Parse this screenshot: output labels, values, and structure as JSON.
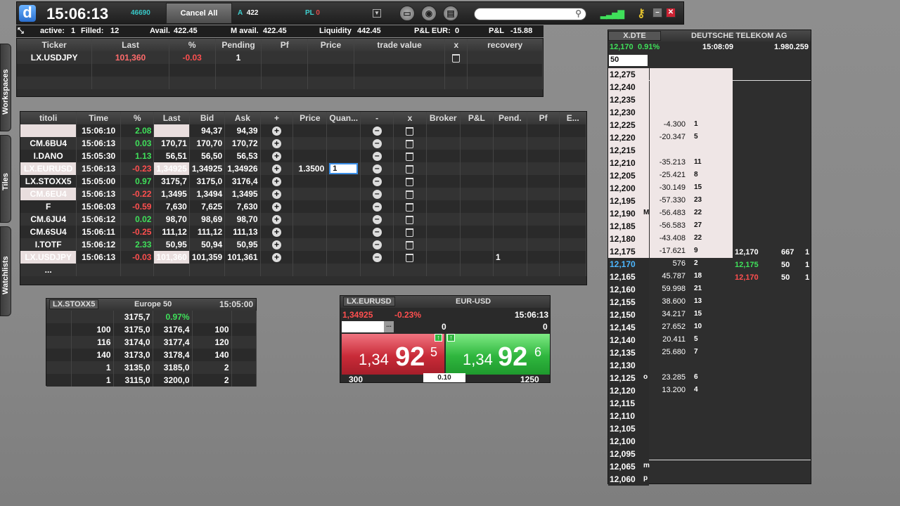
{
  "toolbar": {
    "logo": "d",
    "time": "15:06:13",
    "counter": "46690",
    "cancel_all": "Cancel All",
    "a_label": "A",
    "a_value": "422",
    "pl_label": "PL",
    "pl_value": "0",
    "search_placeholder": ""
  },
  "status": {
    "active_label": "active:",
    "active": "1",
    "filled_label": "Filled:",
    "filled": "12",
    "avail_label": "Avail.",
    "avail": "422.45",
    "mavail_label": "M avail.",
    "mavail": "422.45",
    "liquidity_label": "Liquidity",
    "liquidity": "442.45",
    "pleur_label": "P&L EUR:",
    "pleur": "0",
    "pl_label": "P&L",
    "pl": "-15.88"
  },
  "orders": {
    "columns": [
      "Ticker",
      "Last",
      "%",
      "Pending",
      "Pf",
      "Price",
      "trade value",
      "x",
      "recovery"
    ],
    "rows": [
      {
        "ticker": "LX.USDJPY",
        "last": "101,360",
        "pct": "-0.03",
        "pending": "1"
      }
    ]
  },
  "watchlist": {
    "columns": [
      "titoli",
      "Time",
      "%",
      "Last",
      "Bid",
      "Ask",
      "+",
      "Price",
      "Quan...",
      "-",
      "x",
      "Broker",
      "P&L",
      "Pend.",
      "Pf",
      "E..."
    ],
    "rows": [
      {
        "t": "",
        "time": "15:06:10",
        "pct": "2.08",
        "last": "",
        "bid": "94,37",
        "ask": "94,39",
        "dir": "up",
        "hl": true,
        "lasthl": true
      },
      {
        "t": "CM.6BU4",
        "time": "15:06:13",
        "pct": "0.03",
        "last": "170,71",
        "bid": "170,70",
        "ask": "170,72",
        "dir": "up"
      },
      {
        "t": "I.DANO",
        "time": "15:05:30",
        "pct": "1.13",
        "last": "56,51",
        "bid": "56,50",
        "ask": "56,53",
        "dir": "up"
      },
      {
        "t": "LX.EURUSD",
        "time": "15:06:13",
        "pct": "-0.23",
        "last": "1,34925",
        "bid": "1,34925",
        "ask": "1,34926",
        "dir": "down",
        "hl": true,
        "lasthl": true,
        "price": "1.3500",
        "qty": "1"
      },
      {
        "t": "LX.STOXX5",
        "time": "15:05:00",
        "pct": "0.97",
        "last": "3175,7",
        "bid": "3175,0",
        "ask": "3176,4",
        "dir": "up"
      },
      {
        "t": "CM.6EU4",
        "time": "15:06:13",
        "pct": "-0.22",
        "last": "1,3495",
        "bid": "1,3494",
        "ask": "1,3495",
        "dir": "down",
        "hl": true
      },
      {
        "t": "F",
        "time": "15:06:03",
        "pct": "-0.59",
        "last": "7,630",
        "bid": "7,625",
        "ask": "7,630",
        "dir": "down"
      },
      {
        "t": "CM.6JU4",
        "time": "15:06:12",
        "pct": "0.02",
        "last": "98,70",
        "bid": "98,69",
        "ask": "98,70",
        "dir": "up"
      },
      {
        "t": "CM.6SU4",
        "time": "15:06:11",
        "pct": "-0.25",
        "last": "111,12",
        "bid": "111,12",
        "ask": "111,13",
        "dir": "down"
      },
      {
        "t": "I.TOTF",
        "time": "15:06:12",
        "pct": "2.33",
        "last": "50,95",
        "bid": "50,94",
        "ask": "50,95",
        "dir": "up"
      },
      {
        "t": "LX.USDJPY",
        "time": "15:06:13",
        "pct": "-0.03",
        "last": "101,360",
        "bid": "101,359",
        "ask": "101,361",
        "dir": "down",
        "hl": true,
        "lasthl": true,
        "pend": "1"
      },
      {
        "t": "...",
        "time": "",
        "pct": "",
        "last": "",
        "bid": "",
        "ask": "",
        "dir": "",
        "noicons": true
      }
    ]
  },
  "stoxx": {
    "ticker": "LX.STOXX5",
    "name": "Europe 50",
    "time": "15:05:00",
    "last": "3175,7",
    "pct": "0.97%",
    "rows": [
      [
        "100",
        "3175,0",
        "3176,4",
        "100"
      ],
      [
        "116",
        "3174,0",
        "3177,4",
        "120"
      ],
      [
        "140",
        "3173,0",
        "3178,4",
        "140"
      ],
      [
        "1",
        "3135,0",
        "3185,0",
        "2"
      ],
      [
        "1",
        "3115,0",
        "3200,0",
        "2"
      ]
    ]
  },
  "fx": {
    "ticker": "LX.EURUSD",
    "name": "EUR-USD",
    "last": "1,34925",
    "pct": "-0.23%",
    "time": "15:06:13",
    "qty_left": "0",
    "qty_right": "0",
    "bid_big": "1,34",
    "bid_main": "92",
    "bid_sup": "5",
    "ask_big": "1,34",
    "ask_main": "92",
    "ask_sup": "6",
    "bid_size": "300",
    "spread": "0.10",
    "ask_size": "1250"
  },
  "book": {
    "ticker": "X.DTE",
    "name": "DEUTSCHE TELEKOM AG",
    "price": "12,170",
    "pct": "0.91%",
    "time": "15:08:09",
    "volume": "1.980.259",
    "qty_input": "50",
    "rows": [
      [
        "12,275",
        "",
        "",
        ""
      ],
      [
        "12,240",
        "",
        "",
        ""
      ],
      [
        "12,235",
        "",
        "",
        ""
      ],
      [
        "12,230",
        "",
        "",
        ""
      ],
      [
        "12,225",
        "",
        "-4.300",
        "1"
      ],
      [
        "12,220",
        "",
        "-20.347",
        "5"
      ],
      [
        "12,215",
        "",
        "",
        ""
      ],
      [
        "12,210",
        "",
        "-35.213",
        "11"
      ],
      [
        "12,205",
        "",
        "-25.421",
        "8"
      ],
      [
        "12,200",
        "",
        "-30.149",
        "15"
      ],
      [
        "12,195",
        "",
        "-57.330",
        "23"
      ],
      [
        "12,190",
        "M",
        "-56.483",
        "22"
      ],
      [
        "12,185",
        "",
        "-56.583",
        "27"
      ],
      [
        "12,180",
        "",
        "-43.408",
        "22"
      ],
      [
        "12,175",
        "",
        "-17.621",
        "9"
      ],
      [
        "12,170",
        "",
        "576",
        "2"
      ],
      [
        "12,165",
        "",
        "45.787",
        "18"
      ],
      [
        "12,160",
        "",
        "59.998",
        "21"
      ],
      [
        "12,155",
        "",
        "38.600",
        "13"
      ],
      [
        "12,150",
        "",
        "34.217",
        "15"
      ],
      [
        "12,145",
        "",
        "27.652",
        "10"
      ],
      [
        "12,140",
        "",
        "20.411",
        "5"
      ],
      [
        "12,135",
        "",
        "25.680",
        "7"
      ],
      [
        "12,130",
        "",
        "",
        ""
      ],
      [
        "12,125",
        "o",
        "23.285",
        "6"
      ],
      [
        "12,120",
        "",
        "13.200",
        "4"
      ],
      [
        "12,115",
        "",
        "",
        ""
      ],
      [
        "12,110",
        "",
        "",
        ""
      ],
      [
        "12,105",
        "",
        "",
        ""
      ],
      [
        "12,100",
        "",
        "",
        ""
      ],
      [
        "12,095",
        "",
        "",
        ""
      ],
      [
        "12,065",
        "m",
        "",
        ""
      ],
      [
        "12,060",
        "p",
        "",
        ""
      ]
    ],
    "trades": [
      [
        "12,170",
        "667",
        "1"
      ],
      [
        "12,175",
        "50",
        "1"
      ],
      [
        "12,170",
        "50",
        "1"
      ]
    ]
  },
  "sidetabs": [
    "Workspaces",
    "Tiles",
    "Watchlists"
  ],
  "colors": {
    "green": "#3fe05a",
    "red": "#ff4f4f",
    "accent": "#3fd0d0",
    "bid_panel": "#c92b38",
    "ask_panel": "#2fb63e"
  }
}
